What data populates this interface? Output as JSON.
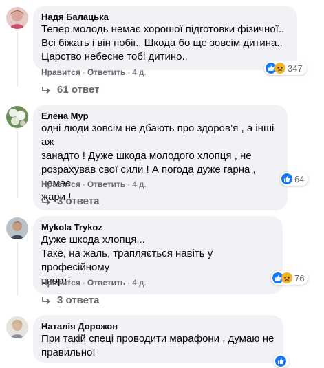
{
  "comments": [
    {
      "author": "Надя Балацька",
      "text": "Тепер молодь немає хорошої підготовки фізичної..\nВсі біжать і він побіг.. Шкода бо ще зовсім дитина..\nЦарство небесне тобі дитино..",
      "like_label": "Нравится",
      "reply_label": "Ответить",
      "time": "4 д.",
      "reaction_count": "347",
      "reaction_icons": [
        "like-icon",
        "sad-icon"
      ],
      "replies_label": "61 ответ"
    },
    {
      "author": "Елена Мур",
      "text": "одні люди зовсім не дбають про здоров’я , а інші аж\nзанадто ! Дуже шкода молодого хлопця , не\nрозрахував свої сили ! А погода дуже гарна , немає\nжари !",
      "like_label": "Нравится",
      "reply_label": "Ответить",
      "time": "4 д.",
      "reaction_count": "64",
      "reaction_icons": [
        "like-icon"
      ],
      "replies_label": "3 ответа"
    },
    {
      "author": "Mykola Trykoz",
      "text": "Дуже шкода хлопця...\nТаке, на жаль, трапляється навіть у професійному\nспорті.",
      "like_label": "Нравится",
      "reply_label": "Ответить",
      "time": "4 д.",
      "reaction_count": "76",
      "reaction_icons": [
        "like-icon",
        "sad-icon"
      ],
      "replies_label": "3 ответа"
    },
    {
      "author": "Наталія Дорожон",
      "text": "При такій спеці проводити марафони , думаю не\nправильно!",
      "reaction_icons": [
        "like-icon"
      ]
    }
  ],
  "colors": {
    "bubble": "#f0f2f5",
    "meta_text": "#65676b",
    "like_blue": "#1877f2",
    "sad_yellow": "#f7b125"
  }
}
